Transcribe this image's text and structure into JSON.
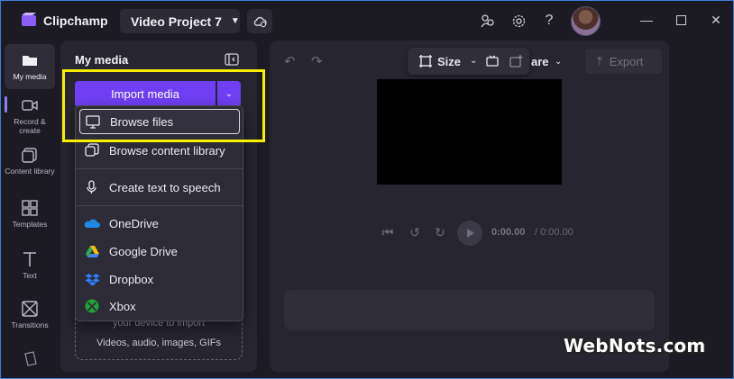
{
  "app": {
    "name": "Clipchamp",
    "project_name": "Video Project 7"
  },
  "leftnav": {
    "items": [
      {
        "label": "My media",
        "icon": "folder-icon"
      },
      {
        "label": "Record & create",
        "icon": "camera-icon"
      },
      {
        "label": "Content library",
        "icon": "library-icon"
      },
      {
        "label": "Templates",
        "icon": "templates-icon"
      },
      {
        "label": "Text",
        "icon": "text-icon"
      },
      {
        "label": "Transitions",
        "icon": "transitions-icon"
      }
    ]
  },
  "media_panel": {
    "title": "My media",
    "import_label": "Import media",
    "drop_line1": "your device to import",
    "drop_line2": "Videos, audio, images, GIFs"
  },
  "import_menu": {
    "items": [
      {
        "label": "Browse files",
        "icon": "monitor-icon"
      },
      {
        "label": "Browse content library",
        "icon": "library-icon"
      },
      {
        "label": "Create text to speech",
        "icon": "microphone-icon"
      },
      {
        "label": "OneDrive",
        "icon": "onedrive-icon"
      },
      {
        "label": "Google Drive",
        "icon": "google-drive-icon"
      },
      {
        "label": "Dropbox",
        "icon": "dropbox-icon"
      },
      {
        "label": "Xbox",
        "icon": "xbox-icon"
      }
    ]
  },
  "editor": {
    "size_label": "Size",
    "share_label": "are",
    "export_label": "Export",
    "time_current": "0:00.00",
    "time_total": "/ 0:00.00"
  },
  "watermark": "WebNots.com",
  "colors": {
    "accent": "#6f3ff5",
    "highlight": "#f5f000",
    "background": "#1c1b24",
    "panel": "#262530"
  }
}
